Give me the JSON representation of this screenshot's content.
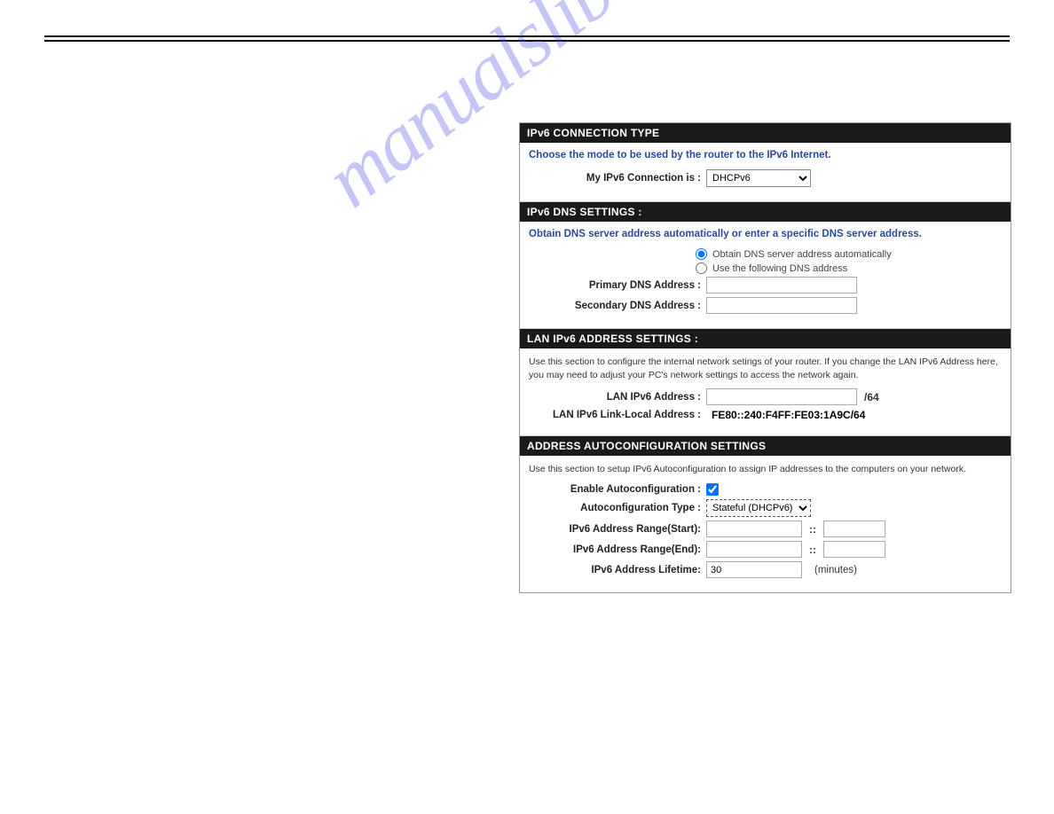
{
  "watermark": "manualslib.com",
  "sections": {
    "connType": {
      "header": "IPv6 CONNECTION TYPE",
      "intro": "Choose the mode to be used by the router to the IPv6 Internet.",
      "connLabel": "My IPv6 Connection is :",
      "connValue": "DHCPv6"
    },
    "dns": {
      "header": "IPv6 DNS SETTINGS :",
      "intro": "Obtain DNS server address automatically or enter a specific DNS server address.",
      "radioAuto": "Obtain DNS server address automatically",
      "radioManual": "Use the following DNS address",
      "primaryLabel": "Primary DNS Address :",
      "secondaryLabel": "Secondary DNS Address :"
    },
    "lan": {
      "header": "LAN IPv6 ADDRESS SETTINGS :",
      "desc": "Use this section to configure the internal network setings of your router. If you change the LAN IPv6 Address here, you may need to adjust your PC's network settings to access the network again.",
      "addrLabel": "LAN IPv6 Address :",
      "addrSuffix": "/64",
      "linkLocalLabel": "LAN IPv6 Link-Local Address :",
      "linkLocalValue": "FE80::240:F4FF:FE03:1A9C/64"
    },
    "auto": {
      "header": "ADDRESS AUTOCONFIGURATION SETTINGS",
      "desc": "Use this section to setup IPv6 Autoconfiguration to assign IP addresses to the computers on your network.",
      "enableLabel": "Enable Autoconfiguration :",
      "typeLabel": "Autoconfiguration Type :",
      "typeValue": "Stateful (DHCPv6)",
      "rangeStartLabel": "IPv6 Address Range(Start):",
      "rangeEndLabel": "IPv6 Address Range(End):",
      "lifetimeLabel": "IPv6 Address Lifetime:",
      "lifetimeValue": "30",
      "lifetimeUnit": "(minutes)",
      "colons": "::"
    }
  }
}
